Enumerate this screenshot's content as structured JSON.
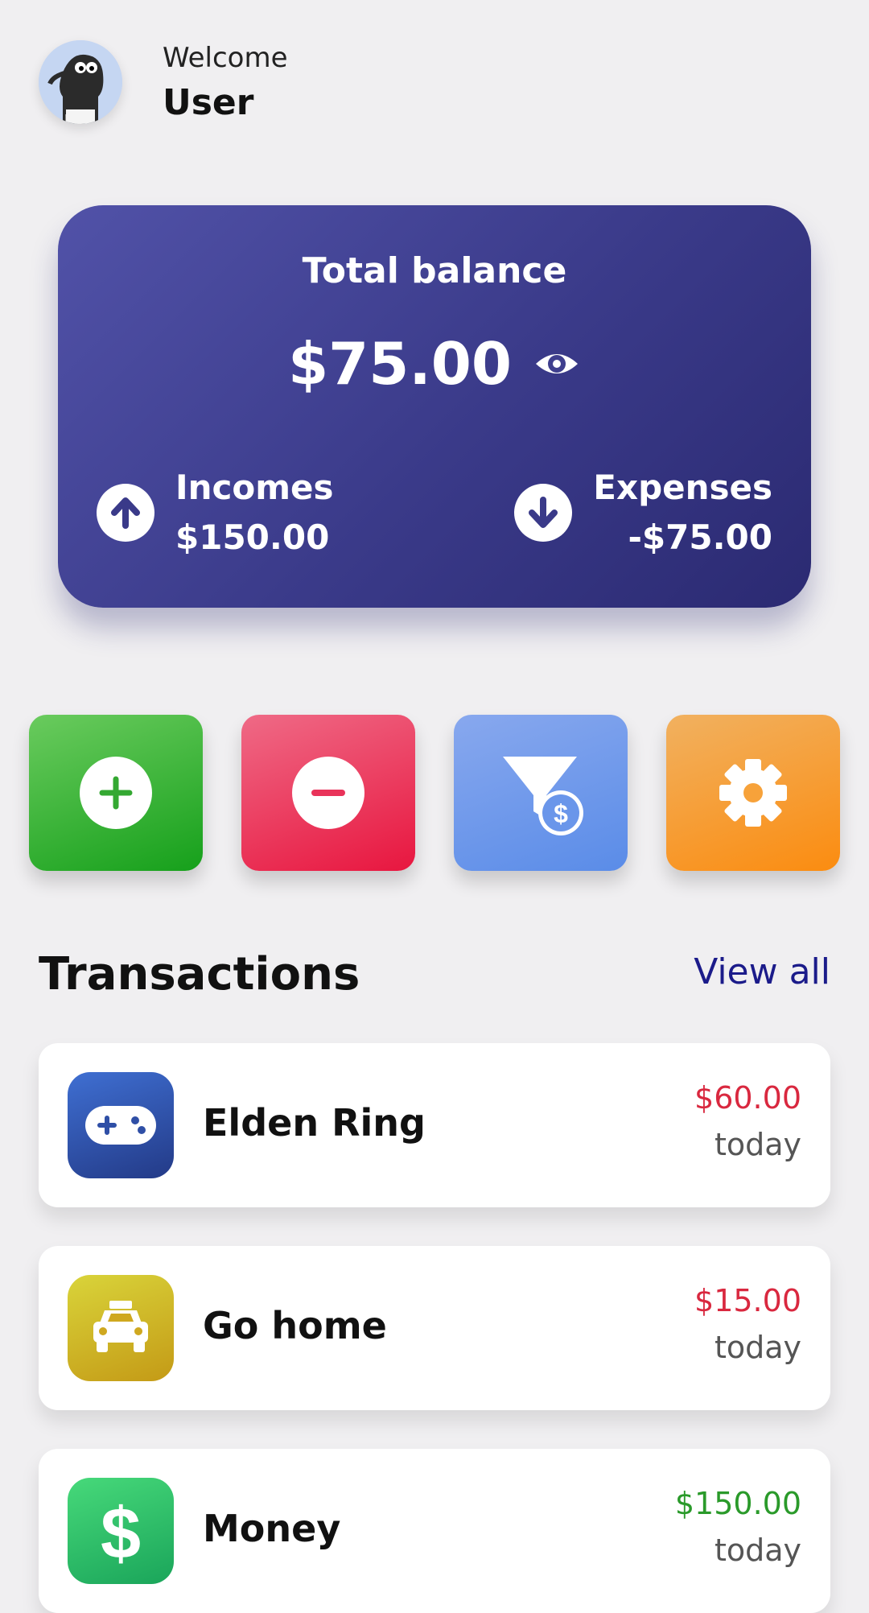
{
  "header": {
    "welcome": "Welcome",
    "username": "User"
  },
  "balance_card": {
    "title": "Total balance",
    "amount": "$75.00",
    "incomes_label": "Incomes",
    "incomes_value": "$150.00",
    "expenses_label": "Expenses",
    "expenses_value": "-$75.00"
  },
  "actions": [
    {
      "icon": "plus-icon",
      "color": "#16a01b"
    },
    {
      "icon": "minus-icon",
      "color": "#e8163f"
    },
    {
      "icon": "filter-dollar-icon",
      "color": "#5a8ce8"
    },
    {
      "icon": "gear-icon",
      "color": "#fb8c10"
    }
  ],
  "transactions": {
    "title": "Transactions",
    "view_all": "View all",
    "items": [
      {
        "name": "Elden Ring",
        "amount": "$60.00",
        "date": "today",
        "icon": "gamepad-icon",
        "amount_color": "#d9283f"
      },
      {
        "name": "Go home",
        "amount": "$15.00",
        "date": "today",
        "icon": "taxi-icon",
        "amount_color": "#d9283f"
      },
      {
        "name": "Money",
        "amount": "$150.00",
        "date": "today",
        "icon": "dollar-icon",
        "amount_color": "#2a9a2a"
      }
    ]
  }
}
